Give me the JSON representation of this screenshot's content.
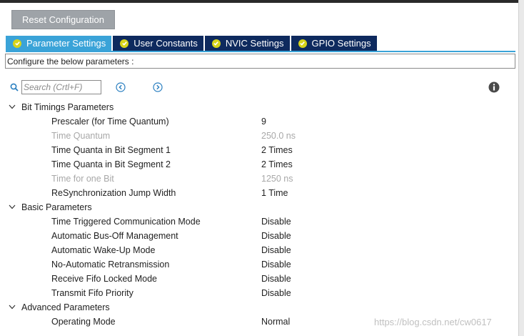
{
  "toolbar": {
    "reset_label": "Reset Configuration"
  },
  "tabs": [
    {
      "label": "Parameter Settings",
      "active": true
    },
    {
      "label": "User Constants",
      "active": false
    },
    {
      "label": "NVIC Settings",
      "active": false
    },
    {
      "label": "GPIO Settings",
      "active": false
    }
  ],
  "config_text": "Configure the below parameters :",
  "search": {
    "placeholder": "Search (Crtl+F)"
  },
  "groups": [
    {
      "label": "Bit Timings Parameters",
      "params": [
        {
          "name": "Prescaler (for Time Quantum)",
          "value": "9",
          "enabled": true
        },
        {
          "name": "Time Quantum",
          "value": "250.0 ns",
          "enabled": false
        },
        {
          "name": "Time Quanta in Bit Segment 1",
          "value": "2 Times",
          "enabled": true
        },
        {
          "name": "Time Quanta in Bit Segment 2",
          "value": "2 Times",
          "enabled": true
        },
        {
          "name": "Time for one Bit",
          "value": "1250 ns",
          "enabled": false
        },
        {
          "name": "ReSynchronization Jump Width",
          "value": "1 Time",
          "enabled": true
        }
      ]
    },
    {
      "label": "Basic Parameters",
      "params": [
        {
          "name": "Time Triggered Communication Mode",
          "value": "Disable",
          "enabled": true
        },
        {
          "name": "Automatic Bus-Off Management",
          "value": "Disable",
          "enabled": true
        },
        {
          "name": "Automatic Wake-Up Mode",
          "value": "Disable",
          "enabled": true
        },
        {
          "name": "No-Automatic Retransmission",
          "value": "Disable",
          "enabled": true
        },
        {
          "name": "Receive Fifo Locked Mode",
          "value": "Disable",
          "enabled": true
        },
        {
          "name": "Transmit Fifo Priority",
          "value": "Disable",
          "enabled": true
        }
      ]
    },
    {
      "label": "Advanced Parameters",
      "params": [
        {
          "name": "Operating Mode",
          "value": "Normal",
          "enabled": true
        }
      ]
    }
  ],
  "watermark": "https://blog.csdn.net/cw0617",
  "colors": {
    "tab_active": "#3aa3d8",
    "tab_inactive": "#0e2a5e",
    "check_badge": "#d7d41a",
    "reset_button": "#9ea3a8",
    "disabled_text": "#a8a8a8"
  },
  "icons": {
    "search": "search-icon",
    "prev": "chevron-left-circle-icon",
    "next": "chevron-right-circle-icon",
    "info": "info-icon",
    "tab_check": "check-circle-icon",
    "group_caret": "chevron-down-icon"
  }
}
